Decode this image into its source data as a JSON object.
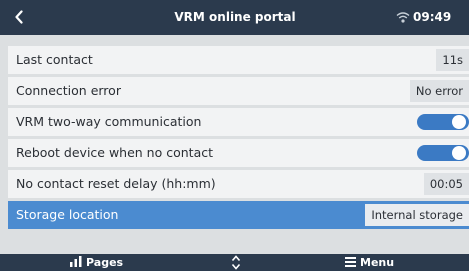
{
  "header": {
    "title": "VRM online portal",
    "time": "09:49",
    "back_icon": "chevron-left-icon",
    "status_icon": "wifi-icon"
  },
  "settings": {
    "last_contact": {
      "label": "Last contact",
      "value": "11s"
    },
    "connection_error": {
      "label": "Connection error",
      "value": "No error"
    },
    "two_way": {
      "label": "VRM two-way communication",
      "enabled": true
    },
    "reboot": {
      "label": "Reboot device when no contact",
      "enabled": true
    },
    "reset_delay": {
      "label": "No contact reset delay (hh:mm)",
      "value": "00:05"
    },
    "storage": {
      "label": "Storage location",
      "value": "Internal storage",
      "selected": true
    }
  },
  "footer": {
    "pages_label": "Pages",
    "menu_label": "Menu",
    "pages_icon": "pages-chart-icon",
    "nav_icon": "up-down-arrows-icon",
    "menu_icon": "hamburger-menu-icon"
  },
  "colors": {
    "header_bg": "#2b3a4d",
    "background": "#dcdfe1",
    "row_bg": "#f2f3f4",
    "accent": "#3b7ac4",
    "selection": "#4b8bd0"
  }
}
